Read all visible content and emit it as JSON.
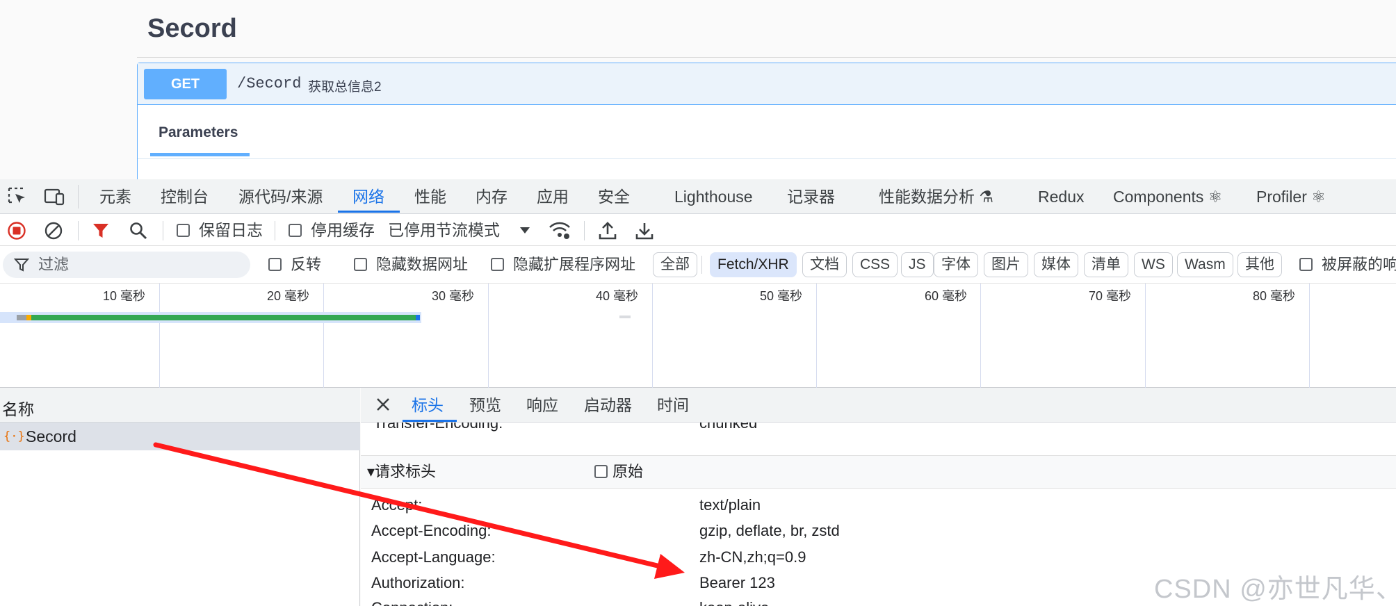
{
  "swagger": {
    "section_title": "Secord",
    "method": "GET",
    "path": "/Secord",
    "description": "获取总信息2",
    "parameters_tab": "Parameters"
  },
  "devtools": {
    "main_tabs": [
      "元素",
      "控制台",
      "源代码/来源",
      "网络",
      "性能",
      "内存",
      "应用",
      "安全",
      "Lighthouse",
      "记录器",
      "性能数据分析 ⚗",
      "Redux",
      "Components ⚛",
      "Profiler ⚛"
    ],
    "active_main_tab": "网络",
    "toolbar": {
      "preserve_log": "保留日志",
      "disable_cache": "停用缓存",
      "throttling": "已停用节流模式"
    },
    "filter": {
      "placeholder": "过滤",
      "invert": "反转",
      "hide_data_urls": "隐藏数据网址",
      "hide_extension_urls": "隐藏扩展程序网址",
      "types": [
        "全部",
        "Fetch/XHR",
        "文档",
        "CSS",
        "JS",
        "字体",
        "图片",
        "媒体",
        "清单",
        "WS",
        "Wasm",
        "其他"
      ],
      "active_type": "Fetch/XHR",
      "blocked_label": "被屏蔽的响"
    },
    "timeline_labels": [
      "10 毫秒",
      "20 毫秒",
      "30 毫秒",
      "40 毫秒",
      "50 毫秒",
      "60 毫秒",
      "70 毫秒",
      "80 毫秒"
    ],
    "request_list": {
      "header": "名称",
      "requests": [
        {
          "name": "Secord"
        }
      ]
    },
    "details": {
      "tabs": [
        "标头",
        "预览",
        "响应",
        "启动器",
        "时间"
      ],
      "active_tab": "标头",
      "partial_row": {
        "key": "Transfer-Encoding:",
        "value": "chunked"
      },
      "section_title": "▾请求标头",
      "raw_label": "原始",
      "headers": [
        {
          "key": "Accept:",
          "value": "text/plain"
        },
        {
          "key": "Accept-Encoding:",
          "value": "gzip, deflate, br, zstd"
        },
        {
          "key": "Accept-Language:",
          "value": "zh-CN,zh;q=0.9"
        },
        {
          "key": "Authorization:",
          "value": "Bearer 123"
        },
        {
          "key": "Connection:",
          "value": "keep-alive"
        }
      ]
    }
  },
  "watermark": "CSDN @亦世凡华、",
  "colors": {
    "swagger_get": "#61affe",
    "devtools_accent": "#1a73e8",
    "record_red": "#d93025",
    "arrow_red": "#ff1a1a",
    "timeline_green": "#34a853"
  }
}
